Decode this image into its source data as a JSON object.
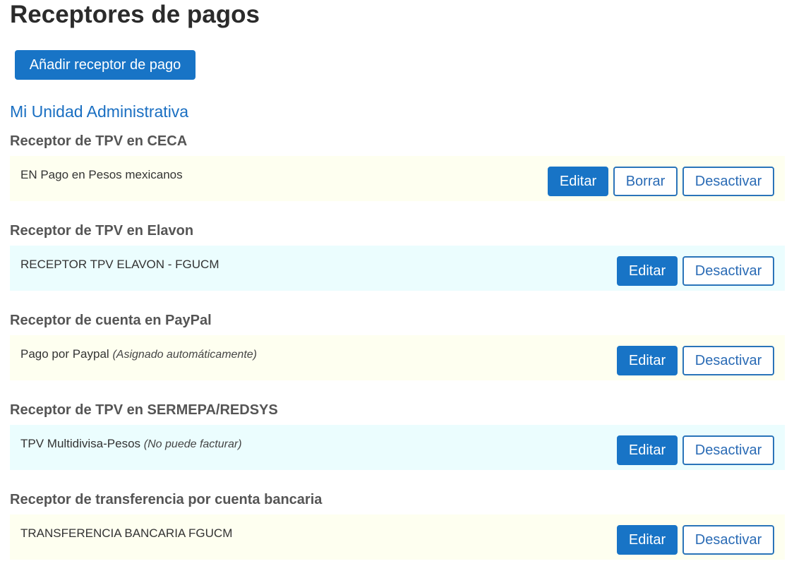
{
  "page": {
    "title": "Receptores de pagos",
    "add_button_label": "Añadir receptor de pago",
    "unit_link": "Mi Unidad Administrativa"
  },
  "sections": [
    {
      "heading": "Receptor de TPV en CECA",
      "row_text": "EN Pago en Pesos mexicanos",
      "row_note": "",
      "row_bg": "#fefff0",
      "actions": {
        "edit": "Editar",
        "delete": "Borrar",
        "deactivate": "Desactivar"
      }
    },
    {
      "heading": "Receptor de TPV en Elavon",
      "row_text": "RECEPTOR TPV ELAVON - FGUCM",
      "row_note": "",
      "row_bg": "#ebfdfe",
      "actions": {
        "edit": "Editar",
        "deactivate": "Desactivar"
      }
    },
    {
      "heading": "Receptor de cuenta en PayPal",
      "row_text": "Pago por Paypal",
      "row_note": "(Asignado automáticamente)",
      "row_bg": "#fefff0",
      "actions": {
        "edit": "Editar",
        "deactivate": "Desactivar"
      }
    },
    {
      "heading": "Receptor de TPV en SERMEPA/REDSYS",
      "row_text": "TPV Multidivisa-Pesos",
      "row_note": "(No puede facturar)",
      "row_bg": "#ebfdfe",
      "actions": {
        "edit": "Editar",
        "deactivate": "Desactivar"
      }
    },
    {
      "heading": "Receptor de transferencia por cuenta bancaria",
      "row_text": "TRANSFERENCIA BANCARIA FGUCM",
      "row_note": "",
      "row_bg": "#fefff0",
      "actions": {
        "edit": "Editar",
        "deactivate": "Desactivar"
      }
    }
  ],
  "colors": {
    "primary_button": "#1874c6",
    "link": "#1a6fc2",
    "outline_border": "#2a74b9",
    "row_yellow": "#fefff0",
    "row_cyan": "#ebfdfe"
  }
}
